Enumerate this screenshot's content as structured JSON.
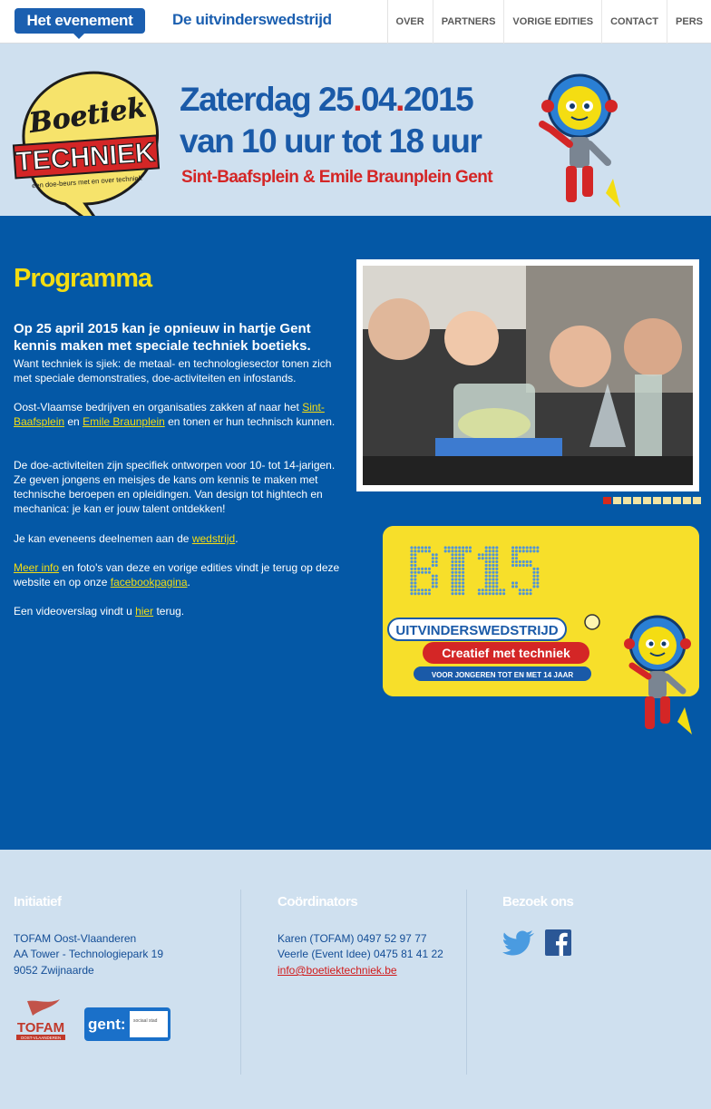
{
  "nav": {
    "active_tab": "Het evenement",
    "second_tab": "De uitvinderswedstrijd",
    "menu": [
      "OVER",
      "PARTNERS",
      "VORIGE EDITIES",
      "CONTACT",
      "PERS"
    ]
  },
  "banner": {
    "logo_line1": "Boetiek",
    "logo_line2": "TECHNIEK",
    "logo_tagline": "een doe-beurs met en over techniek",
    "date_prefix": "Zaterdag 25",
    "date_dot1": ".",
    "date_mid": "04",
    "date_dot2": ".",
    "date_suffix": "2015",
    "time": "van 10 uur tot 18 uur",
    "place": "Sint-Baafsplein & Emile Braunplein Gent"
  },
  "content": {
    "title": "Programma",
    "lead": "Op 25 april 2015 kan je opnieuw in hartje Gent kennis maken met speciale techniek boetieks.",
    "p1": "Want techniek is sjiek: de metaal- en technologiesector tonen zich met speciale demonstraties, doe-activiteiten en infostands.",
    "p2_a": "Oost-Vlaamse bedrijven en organisaties zakken af naar het ",
    "p2_link1": "Sint-Baafsplein",
    "p2_b": " en ",
    "p2_link2": "Emile Braunplein",
    "p2_c": " en tonen er hun technisch kunnen.",
    "p3": "De doe-activiteiten zijn specifiek ontworpen voor 10- tot 14-jarigen. Ze geven jongens en meisjes de kans om kennis te maken met technische beroepen en opleidingen. Van design tot hightech en mechanica: je kan er jouw talent ontdekken!",
    "p4_a": "Je kan eveneens deelnemen aan de ",
    "p4_link": "wedstrijd",
    "p4_b": ".",
    "p5_link": "Meer info",
    "p5_a": " en foto's van deze en vorige edities vindt je terug op deze website en op onze ",
    "p5_link2": "facebookpagina",
    "p5_b": ".",
    "p6_a": "Een videoverslag vindt u ",
    "p6_link": "hier",
    "p6_b": " terug."
  },
  "slider": {
    "count": 10,
    "active": 0
  },
  "bt15": {
    "big": "BT15",
    "label1": "UITVINDERSWEDSTRIJD",
    "label2": "Creatief met techniek",
    "label3": "VOOR JONGEREN TOT EN MET 14 JAAR"
  },
  "footer": {
    "col1_title": "Initiatief",
    "col1_lines": [
      "TOFAM Oost-Vlaanderen",
      "AA Tower - Technologiepark 19",
      "9052 Zwijnaarde"
    ],
    "tofam_logo": "TOFAM",
    "tofam_sub": "OOST-VLAANDEREN",
    "gent_logo": "gent:",
    "gent_sub": "sociaal stad",
    "col2_title": "Coördinators",
    "col2_lines": [
      "Karen (TOFAM) 0497 52 97 77",
      "Veerle (Event Idee) 0475 81 41 22"
    ],
    "col2_email": "info@boetiektechniek.be",
    "col3_title": "Bezoek ons",
    "social": [
      "twitter-icon",
      "facebook-icon"
    ]
  },
  "colors": {
    "brand_blue": "#0458a6",
    "nav_blue": "#1b5fb0",
    "accent_yellow": "#f4dd12",
    "accent_red": "#d42626",
    "light_bg": "#cfe0ef"
  }
}
